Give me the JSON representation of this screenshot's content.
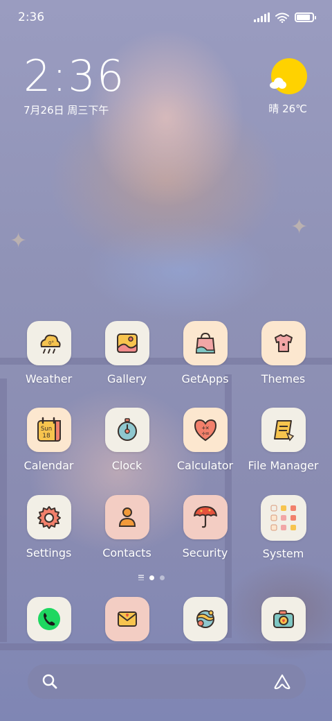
{
  "status_bar": {
    "time": "2:36",
    "icons": [
      "signal-icon",
      "wifi-icon",
      "battery-icon"
    ],
    "battery_level": 0.85
  },
  "clock_widget": {
    "time": "2:36",
    "date": "7月26日 周三下午"
  },
  "weather_widget": {
    "condition_icon": "sun-cloud-icon",
    "text": "晴 26℃"
  },
  "apps": [
    {
      "label": "Weather",
      "icon": "weather-icon"
    },
    {
      "label": "Gallery",
      "icon": "gallery-icon"
    },
    {
      "label": "GetApps",
      "icon": "getapps-icon"
    },
    {
      "label": "Themes",
      "icon": "themes-icon"
    },
    {
      "label": "Calendar",
      "icon": "calendar-icon",
      "icon_text_top": "Sun",
      "icon_text_bottom": "18"
    },
    {
      "label": "Clock",
      "icon": "clock-icon"
    },
    {
      "label": "Calculator",
      "icon": "calculator-icon",
      "icon_text": "+×÷="
    },
    {
      "label": "File Manager",
      "icon": "file-manager-icon"
    },
    {
      "label": "Settings",
      "icon": "settings-icon"
    },
    {
      "label": "Contacts",
      "icon": "contacts-icon"
    },
    {
      "label": "Security",
      "icon": "security-icon"
    },
    {
      "label": "System",
      "icon": "system-folder-icon"
    }
  ],
  "page_indicator": {
    "pages": 2,
    "active": 0
  },
  "dock": [
    {
      "icon": "phone-icon"
    },
    {
      "icon": "messages-icon"
    },
    {
      "icon": "browser-icon"
    },
    {
      "icon": "camera-icon"
    }
  ],
  "search_bar": {
    "left_icon": "search-icon",
    "right_icon": "assistant-icon"
  },
  "colors": {
    "sun": "#ffd200",
    "phone_green": "#1ed760",
    "icon_outline": "#3a2f2a"
  }
}
